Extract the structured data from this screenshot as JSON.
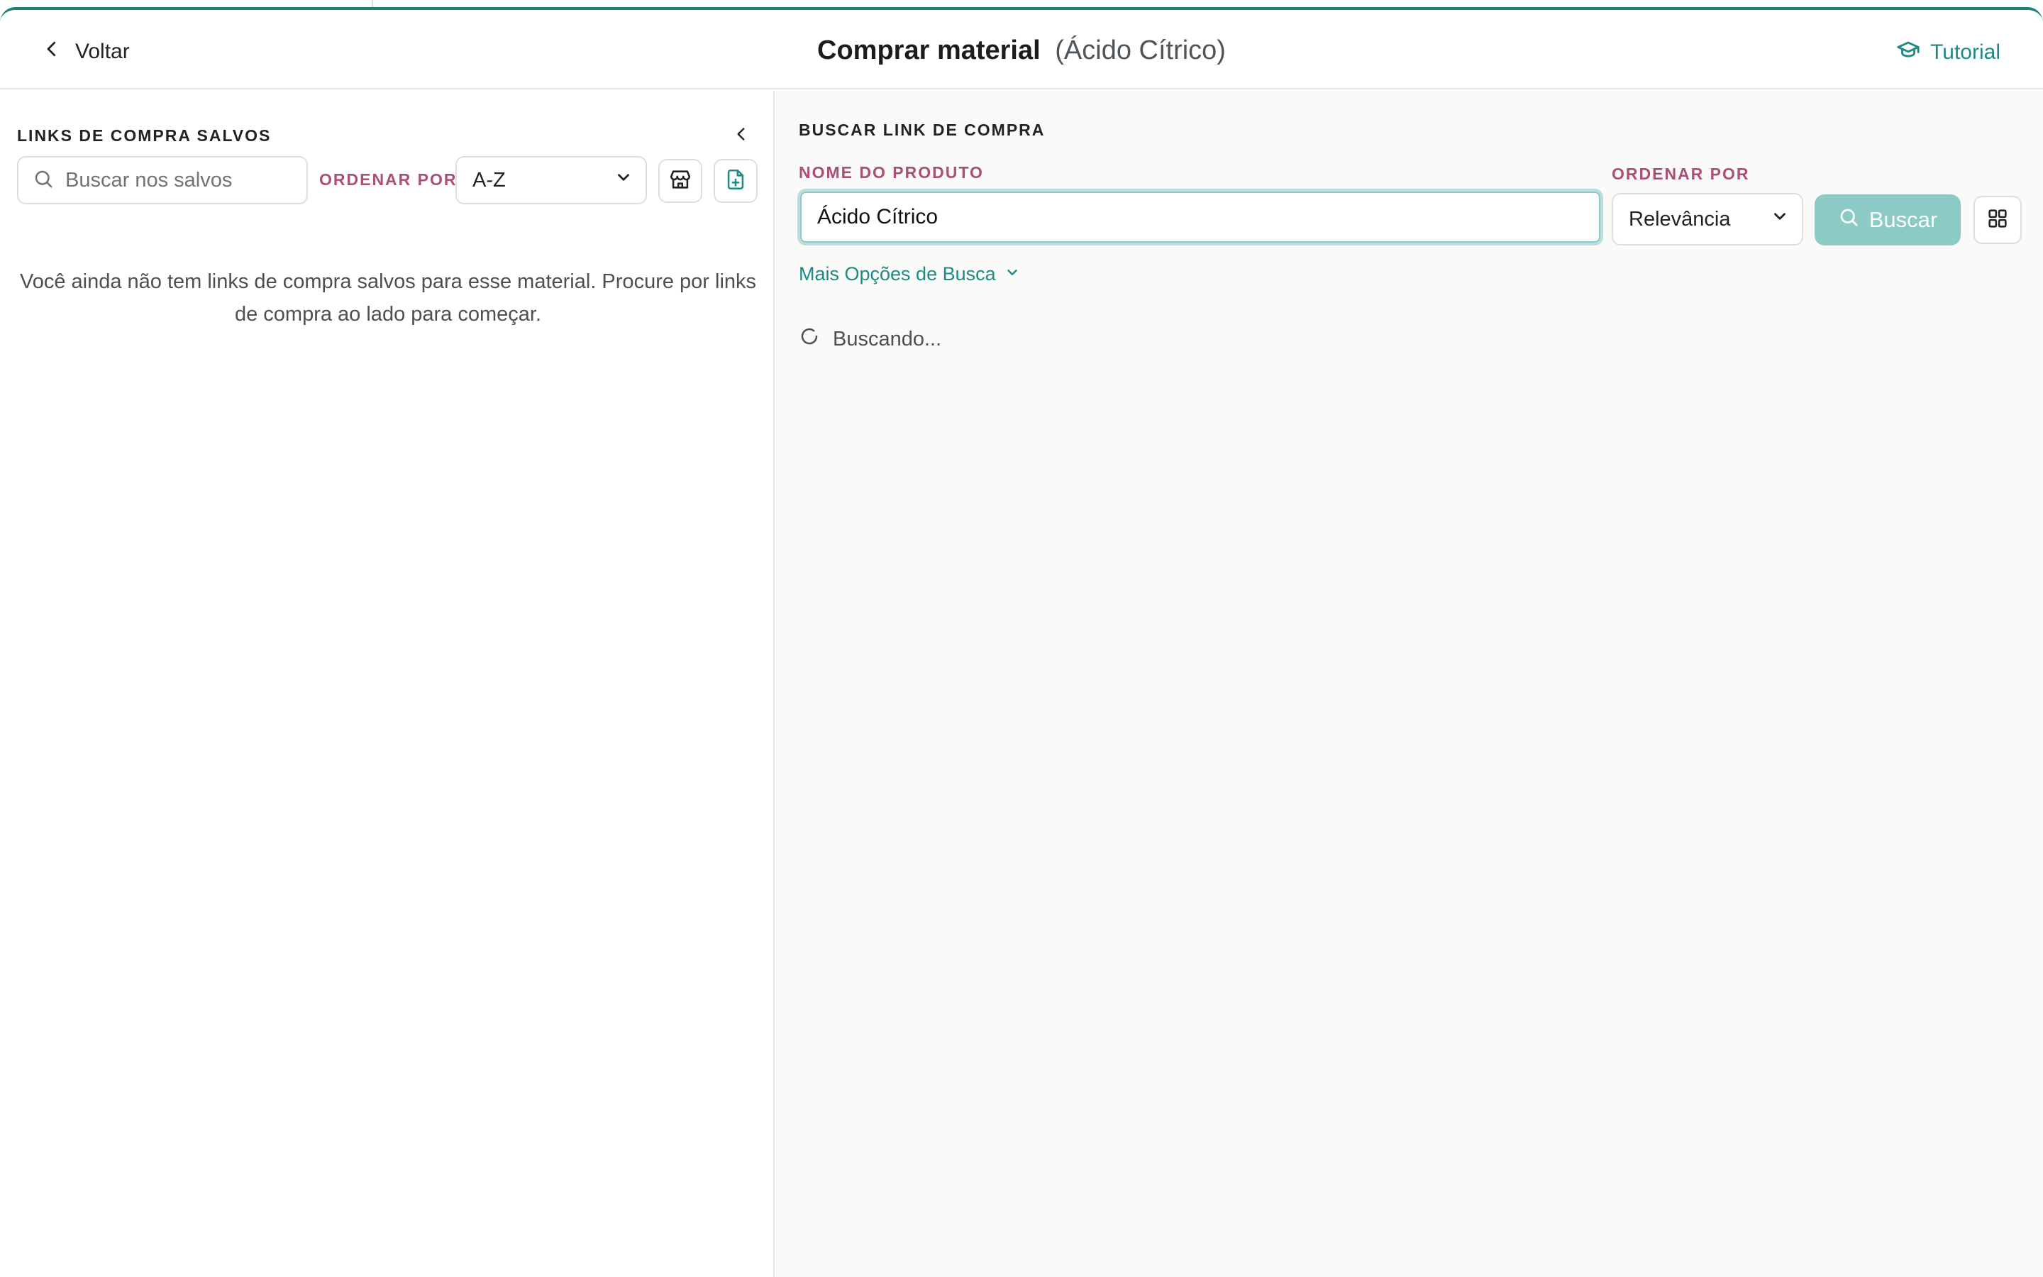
{
  "header": {
    "back_label": "Voltar",
    "title": "Comprar material",
    "subtitle": "(Ácido Cítrico)",
    "tutorial_label": "Tutorial"
  },
  "saved_links": {
    "title": "LINKS DE COMPRA SALVOS",
    "search_placeholder": "Buscar nos salvos",
    "order_label": "ORDENAR POR",
    "order_value": "A-Z",
    "empty_message": "Você ainda não tem links de compra salvos para esse material. Procure por links de compra ao lado para começar."
  },
  "search": {
    "title": "BUSCAR LINK DE COMPRA",
    "product_label": "NOME DO PRODUTO",
    "product_value": "Ácido Cítrico",
    "order_label": "ORDENAR POR",
    "order_value": "Relevância",
    "search_button": "Buscar",
    "more_options": "Mais Opções de Busca",
    "loading_text": "Buscando..."
  },
  "colors": {
    "accent_teal": "#1e8a84",
    "label_rose": "#a94f78",
    "button_disabled": "#8ccac6"
  }
}
